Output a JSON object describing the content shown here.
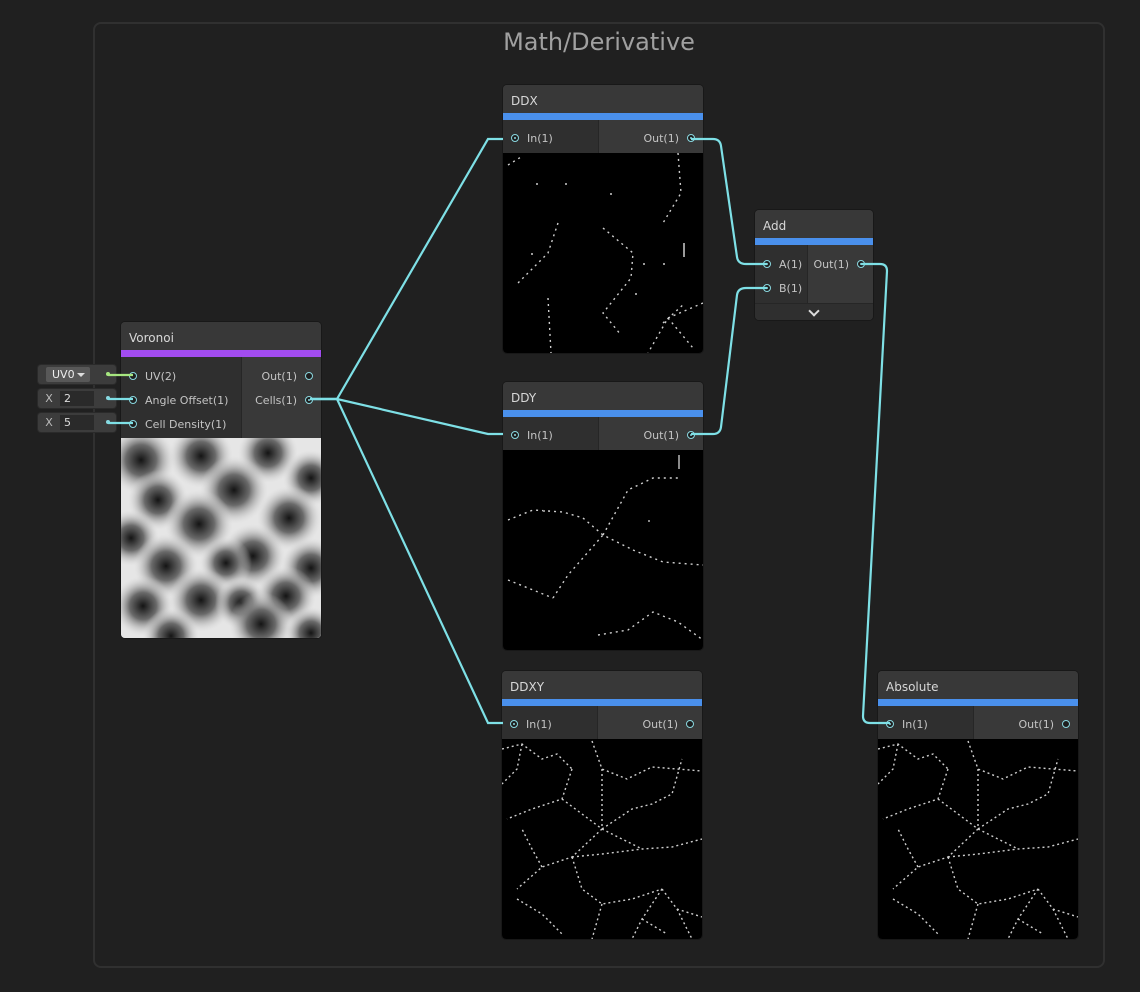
{
  "group": {
    "title": "Math/Derivative"
  },
  "nodes": {
    "voronoi": {
      "title": "Voronoi",
      "inputs": [
        "UV(2)",
        "Angle Offset(1)",
        "Cell Density(1)"
      ],
      "outputs": [
        "Out(1)",
        "Cells(1)"
      ]
    },
    "ddx": {
      "title": "DDX",
      "input": "In(1)",
      "output": "Out(1)"
    },
    "ddy": {
      "title": "DDY",
      "input": "In(1)",
      "output": "Out(1)"
    },
    "ddxy": {
      "title": "DDXY",
      "input": "In(1)",
      "output": "Out(1)"
    },
    "add": {
      "title": "Add",
      "inputs": [
        "A(1)",
        "B(1)"
      ],
      "output": "Out(1)"
    },
    "absolute": {
      "title": "Absolute",
      "input": "In(1)",
      "output": "Out(1)"
    }
  },
  "inline_inputs": {
    "uv": {
      "value": "UV0"
    },
    "angle_offset": {
      "label": "X",
      "value": "2"
    },
    "cell_density": {
      "label": "X",
      "value": "5"
    }
  },
  "colors": {
    "wire": "#7ee0e6",
    "uv_wire": "#a6e67f",
    "header_bar": "#4a90ec",
    "voronoi_bar": "#a24cf0"
  }
}
